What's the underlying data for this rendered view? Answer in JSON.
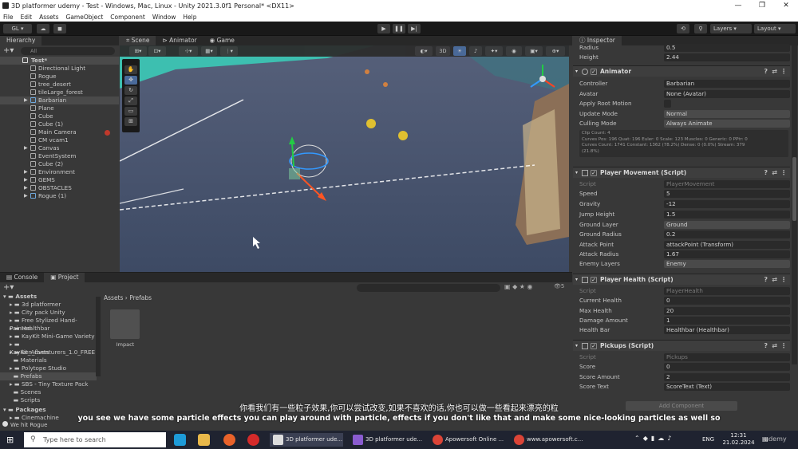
{
  "window": {
    "title": "3D platformer udemy - Test - Windows, Mac, Linux - Unity 2021.3.0f1 Personal* <DX11>",
    "controls": [
      "—",
      "❐",
      "✕"
    ]
  },
  "menu": [
    "File",
    "Edit",
    "Assets",
    "GameObject",
    "Component",
    "Window",
    "Help"
  ],
  "toolbar": {
    "account": "GL ▾",
    "layers": "Layers",
    "layout": "Layout"
  },
  "hierarchy": {
    "tab": "Hierarchy",
    "search_placeholder": "All",
    "scene": "Test*",
    "items": [
      "Directional Light",
      "Rogue",
      "tree_desert",
      "tileLarge_forest",
      "Barbarian",
      "Plane",
      "Cube",
      "Cube (1)",
      "Main Camera",
      "CM vcam1",
      "Canvas",
      "EventSystem",
      "Cube (2)",
      "Environment",
      "GEMS",
      "OBSTACLES",
      "Rogue (1)"
    ]
  },
  "scene_tabs": [
    "Scene",
    "Animator",
    "Game"
  ],
  "scene_toolbar": {
    "mode": "3D"
  },
  "bottom_tabs": [
    "Console",
    "Project"
  ],
  "project": {
    "tree_header": "Assets",
    "tree": [
      "3d platformer",
      "City pack Unity",
      "Free Stylized Hand-Painted",
      "Healthbar",
      "KayKit Mini-Game Variety",
      "KayKit_Adventurers_1.0_FREE",
      "ken_fonts",
      "Materials",
      "Polytope Studio",
      "Prefabs",
      "SBS - Tiny Texture Pack",
      "Scenes",
      "Scripts"
    ],
    "packages": "Packages",
    "package_item": "Cinemachine",
    "breadcrumb": [
      "Assets",
      "Prefabs"
    ],
    "asset_label": "Impact",
    "search_count": "5"
  },
  "inspector": {
    "tab": "Inspector",
    "top_rows": [
      {
        "k": "Radius",
        "v": "0.5"
      },
      {
        "k": "Height",
        "v": "2.44"
      }
    ],
    "animator": {
      "title": "Animator",
      "rows": [
        {
          "k": "Controller",
          "v": "Barbarian"
        },
        {
          "k": "Avatar",
          "v": "None (Avatar)"
        },
        {
          "k": "Apply Root Motion",
          "v": ""
        },
        {
          "k": "Update Mode",
          "v": "Normal"
        },
        {
          "k": "Culling Mode",
          "v": "Always Animate"
        }
      ],
      "info": [
        "Clip Count: 4",
        "Curves Pos: 196 Quat: 196 Euler: 0 Scale: 123 Muscles: 0 Generic: 0 PPtr: 0",
        "Curves Count: 1741 Constant: 1362 (78.2%) Dense: 0 (0.0%) Stream: 379",
        "(21.8%)"
      ]
    },
    "player_movement": {
      "title": "Player Movement (Script)",
      "rows": [
        {
          "k": "Script",
          "v": "PlayerMovement"
        },
        {
          "k": "Speed",
          "v": "5"
        },
        {
          "k": "Gravity",
          "v": "-12"
        },
        {
          "k": "Jump Height",
          "v": "1.5"
        },
        {
          "k": "Ground Layer",
          "v": "Ground"
        },
        {
          "k": "Ground Radius",
          "v": "0.2"
        },
        {
          "k": "Attack Point",
          "v": "attackPoint (Transform)"
        },
        {
          "k": "Attack Radius",
          "v": "1.67"
        },
        {
          "k": "Enemy Layers",
          "v": "Enemy"
        }
      ]
    },
    "player_health": {
      "title": "Player Health (Script)",
      "rows": [
        {
          "k": "Script",
          "v": "PlayerHealth"
        },
        {
          "k": "Current Health",
          "v": "0"
        },
        {
          "k": "Max Health",
          "v": "20"
        },
        {
          "k": "Damage Amount",
          "v": "1"
        },
        {
          "k": "Health Bar",
          "v": "Healthbar (Healthbar)"
        }
      ]
    },
    "pickups": {
      "title": "Pickups (Script)",
      "rows": [
        {
          "k": "Script",
          "v": "Pickups"
        },
        {
          "k": "Score",
          "v": "0"
        },
        {
          "k": "Score Amount",
          "v": "2"
        },
        {
          "k": "Score Text",
          "v": "ScoreText (Text)"
        }
      ]
    },
    "add_component": "Add Component"
  },
  "status": {
    "text": "We hit Rogue"
  },
  "subtitles": {
    "zh": "你看我们有一些粒子效果,你可以尝试改变,如果不喜欢的话,你也可以做一些看起来漂亮的粒",
    "en": "you see we have some particle effects you can play around with particle, effects if you don't like that and make some nice-looking particles as well so"
  },
  "taskbar": {
    "search_placeholder": "Type here to search",
    "apps": [
      "3D platformer ude...",
      "3D platformer ude...",
      "Apowersoft Online ...",
      "www.apowersoft.c..."
    ],
    "lang": "ENG",
    "time": "12:31",
    "date": "21.02.2024"
  },
  "watermark": "udemy"
}
